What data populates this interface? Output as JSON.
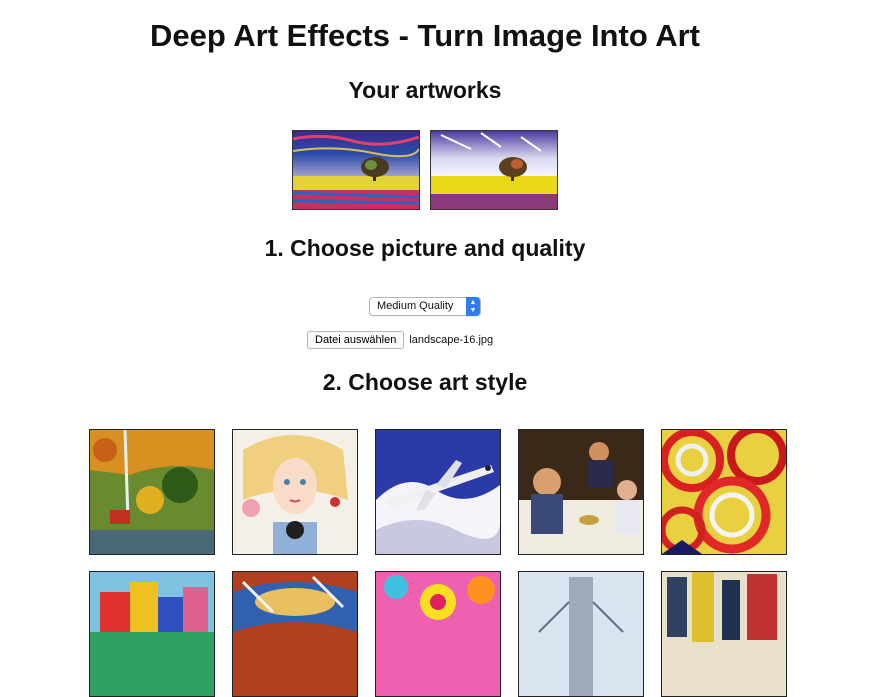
{
  "page": {
    "title": "Deep Art Effects - Turn Image Into Art"
  },
  "artworks": {
    "heading": "Your artworks",
    "items": [
      {
        "name": "artwork-1"
      },
      {
        "name": "artwork-2"
      }
    ]
  },
  "step1": {
    "heading": "1. Choose picture and quality",
    "quality_select": {
      "selected": "Medium Quality"
    },
    "file_button_label": "Datei auswählen",
    "file_name": "landscape-16.jpg"
  },
  "step2": {
    "heading": "2. Choose art style"
  },
  "colors": {
    "select_accent": "#2f7bf5",
    "border": "#222222"
  }
}
